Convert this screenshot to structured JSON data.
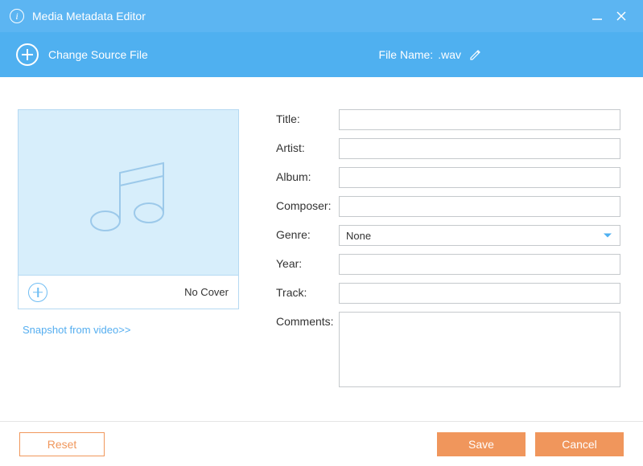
{
  "titleBar": {
    "title": "Media Metadata Editor"
  },
  "toolbar": {
    "changeSourceLabel": "Change Source File",
    "fileNameLabel": "File Name:",
    "fileNameValue": ".wav"
  },
  "cover": {
    "noCoverText": "No Cover",
    "snapshotLink": "Snapshot from video>>"
  },
  "form": {
    "labels": {
      "title": "Title:",
      "artist": "Artist:",
      "album": "Album:",
      "composer": "Composer:",
      "genre": "Genre:",
      "year": "Year:",
      "track": "Track:",
      "comments": "Comments:"
    },
    "values": {
      "title": "",
      "artist": "",
      "album": "",
      "composer": "",
      "genre": "None",
      "year": "",
      "track": "",
      "comments": ""
    }
  },
  "footer": {
    "reset": "Reset",
    "save": "Save",
    "cancel": "Cancel"
  }
}
